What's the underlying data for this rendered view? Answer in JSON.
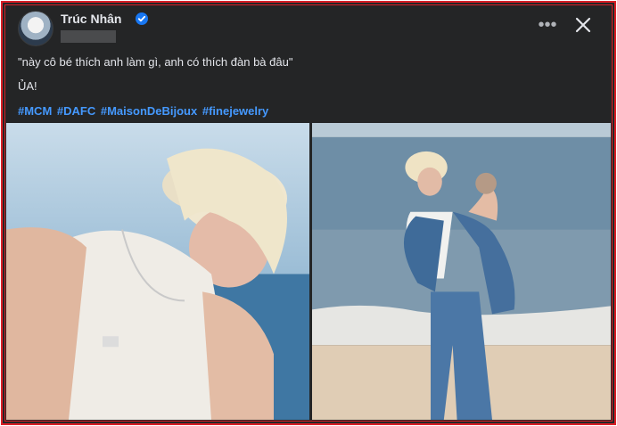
{
  "post": {
    "author": "Trúc Nhân",
    "verified": true,
    "lines": [
      "\"này cô bé thích anh làm gì, anh có thích đàn bà đâu\"",
      "ỦA!"
    ],
    "hashtags": [
      "#MCM",
      "#DAFC",
      "#MaisonDeBijoux",
      "#finejewelry"
    ],
    "more_label": "•••"
  },
  "icons": {
    "verified": "verified-badge-icon",
    "more": "more-options-icon",
    "close": "close-icon"
  },
  "colors": {
    "background": "#242526",
    "text": "#e4e6eb",
    "hashtag": "#4599ff",
    "verified_badge": "#1877f2",
    "border": "#d91f26"
  }
}
